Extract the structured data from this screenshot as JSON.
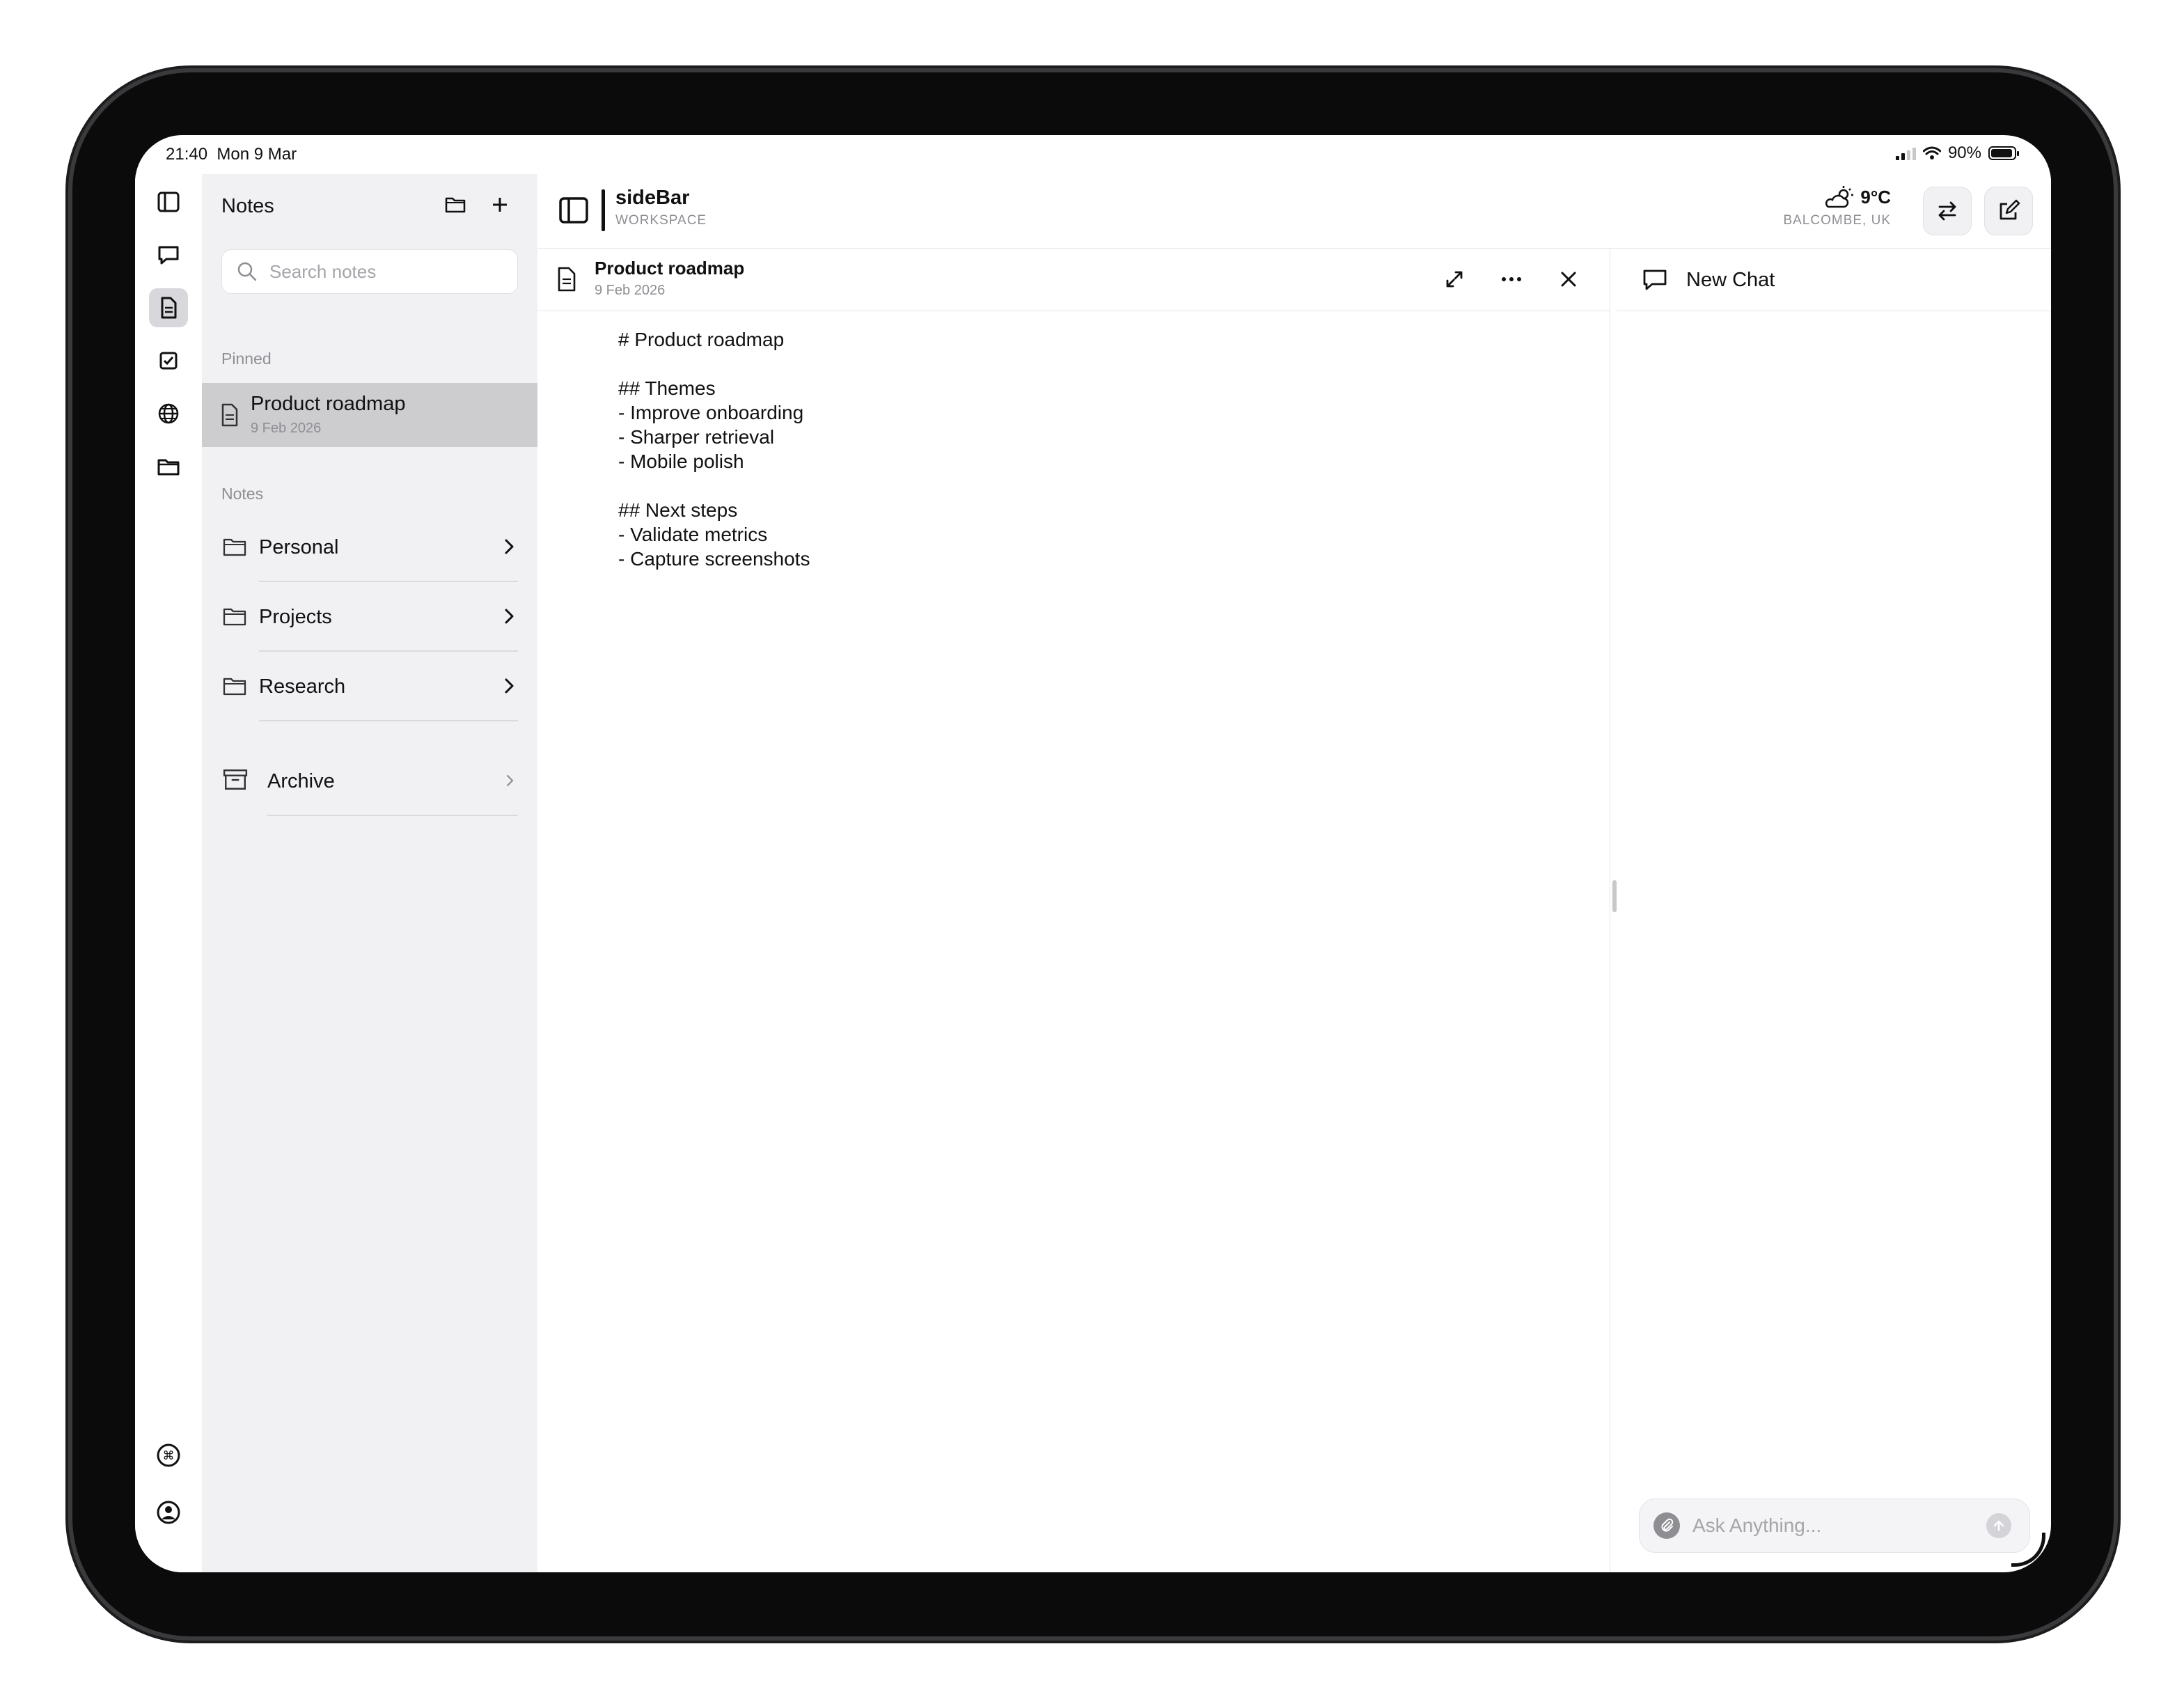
{
  "status_bar": {
    "time": "21:40",
    "date": "Mon 9 Mar",
    "battery": "90%"
  },
  "rail": {
    "icons": [
      "sidebar-toggle-icon",
      "chat-bubble-icon",
      "document-icon",
      "checkbox-icon",
      "globe-icon",
      "folder-icon",
      "command-icon",
      "user-circle-icon"
    ],
    "active": "document-icon"
  },
  "notes_panel": {
    "title": "Notes",
    "search_placeholder": "Search notes",
    "pinned_label": "Pinned",
    "pinned": {
      "title": "Product roadmap",
      "date": "9 Feb 2026"
    },
    "notes_label": "Notes",
    "folders": [
      {
        "label": "Personal"
      },
      {
        "label": "Projects"
      },
      {
        "label": "Research"
      }
    ],
    "archive_label": "Archive"
  },
  "header": {
    "app_name": "sideBar",
    "workspace_label": "WORKSPACE",
    "weather_temp": "9°C",
    "weather_location": "BALCOMBE, UK"
  },
  "document": {
    "title": "Product roadmap",
    "date": "9 Feb 2026",
    "content": "# Product roadmap\n\n## Themes\n- Improve onboarding\n- Sharper retrieval\n- Mobile polish\n\n## Next steps\n- Validate metrics\n- Capture screenshots"
  },
  "chat": {
    "title": "New Chat",
    "input_placeholder": "Ask Anything..."
  },
  "colors": {
    "selected_row": "#cdcdd0",
    "sidebar_bg": "#f1f1f4",
    "text": "#111111",
    "muted": "#8e8e93"
  }
}
